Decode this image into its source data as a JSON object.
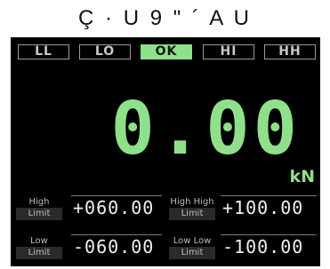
{
  "caption": "Ç · U 9 \" ´ A U",
  "tabs": [
    "LL",
    "LO",
    "OK",
    "HI",
    "HH"
  ],
  "active_tab": "OK",
  "display": {
    "value": "0.00",
    "unit": "kN"
  },
  "limits": {
    "high": {
      "label_1": "High",
      "label_2": "Limit",
      "value": "+060.00"
    },
    "high_high": {
      "label_1": "High High",
      "label_2": "Limit",
      "value": "+100.00"
    },
    "low": {
      "label_1": "Low",
      "label_2": "Limit",
      "value": "-060.00"
    },
    "low_low": {
      "label_1": "Low Low",
      "label_2": "Limit",
      "value": "-100.00"
    }
  },
  "colors": {
    "accent": "#8fe08a",
    "background": "#000000"
  }
}
